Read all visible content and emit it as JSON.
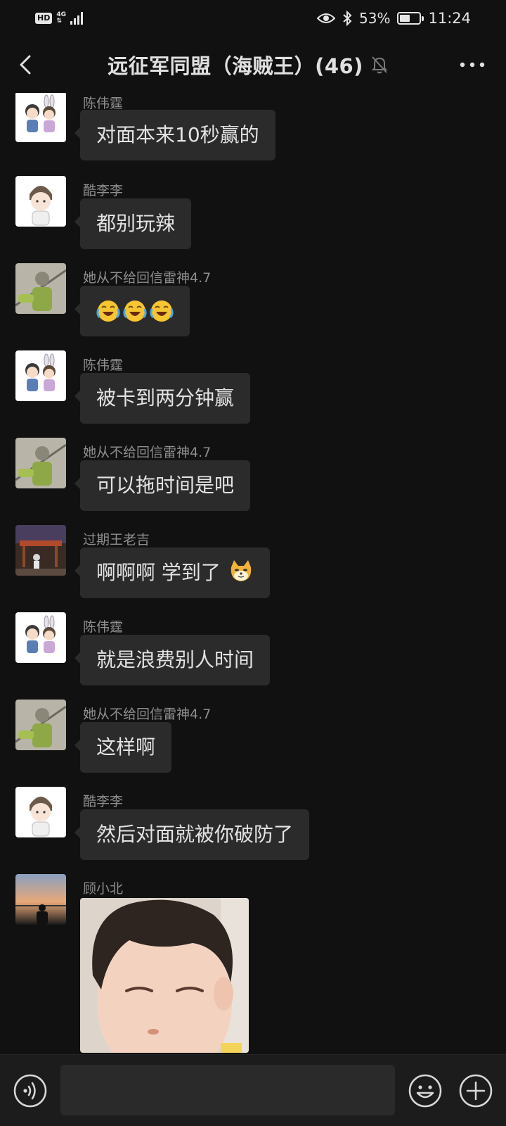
{
  "status_bar": {
    "hd": "HD",
    "network_top": "4G",
    "network_bottom": "⇅",
    "battery_percent": "53%",
    "battery_level": 0.53,
    "time": "11:24"
  },
  "header": {
    "title": "远征军同盟（海贼王）(46)",
    "back_icon": "back-chevron-icon",
    "mute_icon": "bell-muted-icon",
    "more_icon": "more-dots-icon"
  },
  "messages": [
    {
      "sender": "陈伟霆",
      "avatar": "avatar-couple-cartoon",
      "text": "对面本来10秒赢的"
    },
    {
      "sender": "酷李李",
      "avatar": "avatar-cartoon-boy",
      "text": "都别玩辣"
    },
    {
      "sender": "她从不给回信雷神4.7",
      "avatar": "avatar-anime-character",
      "emoji": [
        "loudly-laughing-emoji",
        "loudly-laughing-emoji",
        "loudly-laughing-emoji"
      ]
    },
    {
      "sender": "陈伟霆",
      "avatar": "avatar-couple-cartoon",
      "text": "被卡到两分钟赢"
    },
    {
      "sender": "她从不给回信雷神4.7",
      "avatar": "avatar-anime-character",
      "text": "可以拖时间是吧"
    },
    {
      "sender": "过期王老吉",
      "avatar": "avatar-photo-street",
      "text": "啊啊啊 学到了",
      "trailing_emoji": "doge-cat-emoji"
    },
    {
      "sender": "陈伟霆",
      "avatar": "avatar-couple-cartoon",
      "text": "就是浪费别人时间"
    },
    {
      "sender": "她从不给回信雷神4.7",
      "avatar": "avatar-anime-character",
      "text": "这样啊"
    },
    {
      "sender": "酷李李",
      "avatar": "avatar-cartoon-boy",
      "text": "然后对面就被你破防了"
    },
    {
      "sender": "顾小北",
      "avatar": "avatar-photo-sunset",
      "image": "toddler-photo"
    }
  ],
  "input_bar": {
    "voice_icon": "voice-input-icon",
    "input_value": "",
    "emoji_icon": "emoji-face-icon",
    "plus_icon": "plus-circle-icon"
  },
  "colors": {
    "background": "#111111",
    "bubble": "#2b2b2b",
    "sender_text": "#8e8e8e",
    "message_text": "#e3e3e3",
    "input_bar": "#1c1c1c"
  }
}
